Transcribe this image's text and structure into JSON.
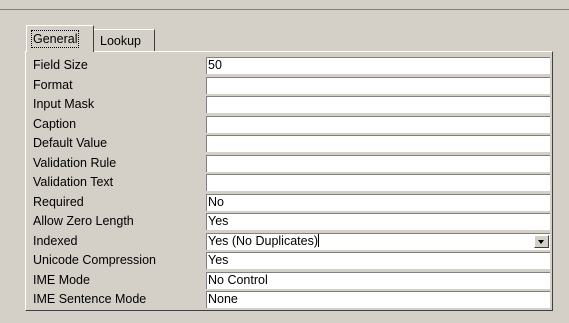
{
  "tabs": [
    {
      "label": "General",
      "active": true
    },
    {
      "label": "Lookup",
      "active": false
    }
  ],
  "properties": [
    {
      "label": "Field Size",
      "value": "50"
    },
    {
      "label": "Format",
      "value": ""
    },
    {
      "label": "Input Mask",
      "value": ""
    },
    {
      "label": "Caption",
      "value": ""
    },
    {
      "label": "Default Value",
      "value": ""
    },
    {
      "label": "Validation Rule",
      "value": ""
    },
    {
      "label": "Validation Text",
      "value": ""
    },
    {
      "label": "Required",
      "value": "No"
    },
    {
      "label": "Allow Zero Length",
      "value": "Yes"
    },
    {
      "label": "Indexed",
      "value": "Yes (No Duplicates)",
      "has_dropdown": true,
      "focused": true
    },
    {
      "label": "Unicode Compression",
      "value": "Yes"
    },
    {
      "label": "IME Mode",
      "value": "No Control"
    },
    {
      "label": "IME Sentence Mode",
      "value": "None"
    }
  ],
  "icons": {
    "dropdown": "dropdown-arrow-icon"
  }
}
